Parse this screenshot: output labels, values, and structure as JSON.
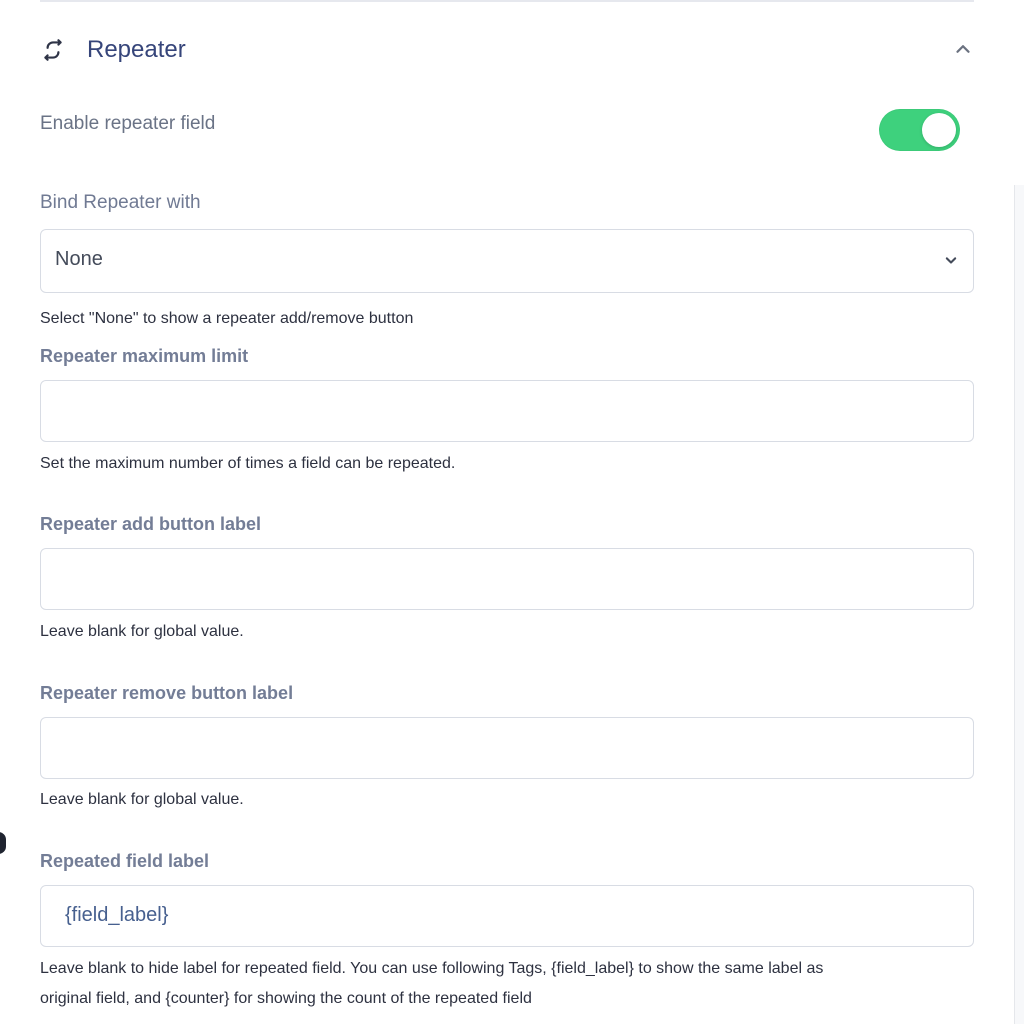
{
  "section": {
    "title": "Repeater"
  },
  "toggle": {
    "label": "Enable repeater field",
    "state": "on",
    "color": "#3ed17d"
  },
  "bind": {
    "label": "Bind Repeater with",
    "selected": "None",
    "help": "Select \"None\" to show a repeater add/remove button"
  },
  "max_limit": {
    "label": "Repeater maximum limit",
    "value": "",
    "help": "Set the maximum number of times a field can be repeated."
  },
  "add_label": {
    "label": "Repeater add button label",
    "value": "",
    "help": "Leave blank for global value."
  },
  "remove_label": {
    "label": "Repeater remove button label",
    "value": "",
    "help": "Leave blank for global value."
  },
  "repeated_field_label": {
    "label": "Repeated field label",
    "value": "{field_label}",
    "help_line1": "Leave blank to hide label for repeated field. You can use following Tags, {field_label} to show the same label as",
    "help_line2": "original field, and {counter} for showing the count of the repeated field"
  },
  "icons": {
    "section": "repeat-icon",
    "collapse": "chevron-up-icon",
    "select": "chevron-down-icon"
  }
}
